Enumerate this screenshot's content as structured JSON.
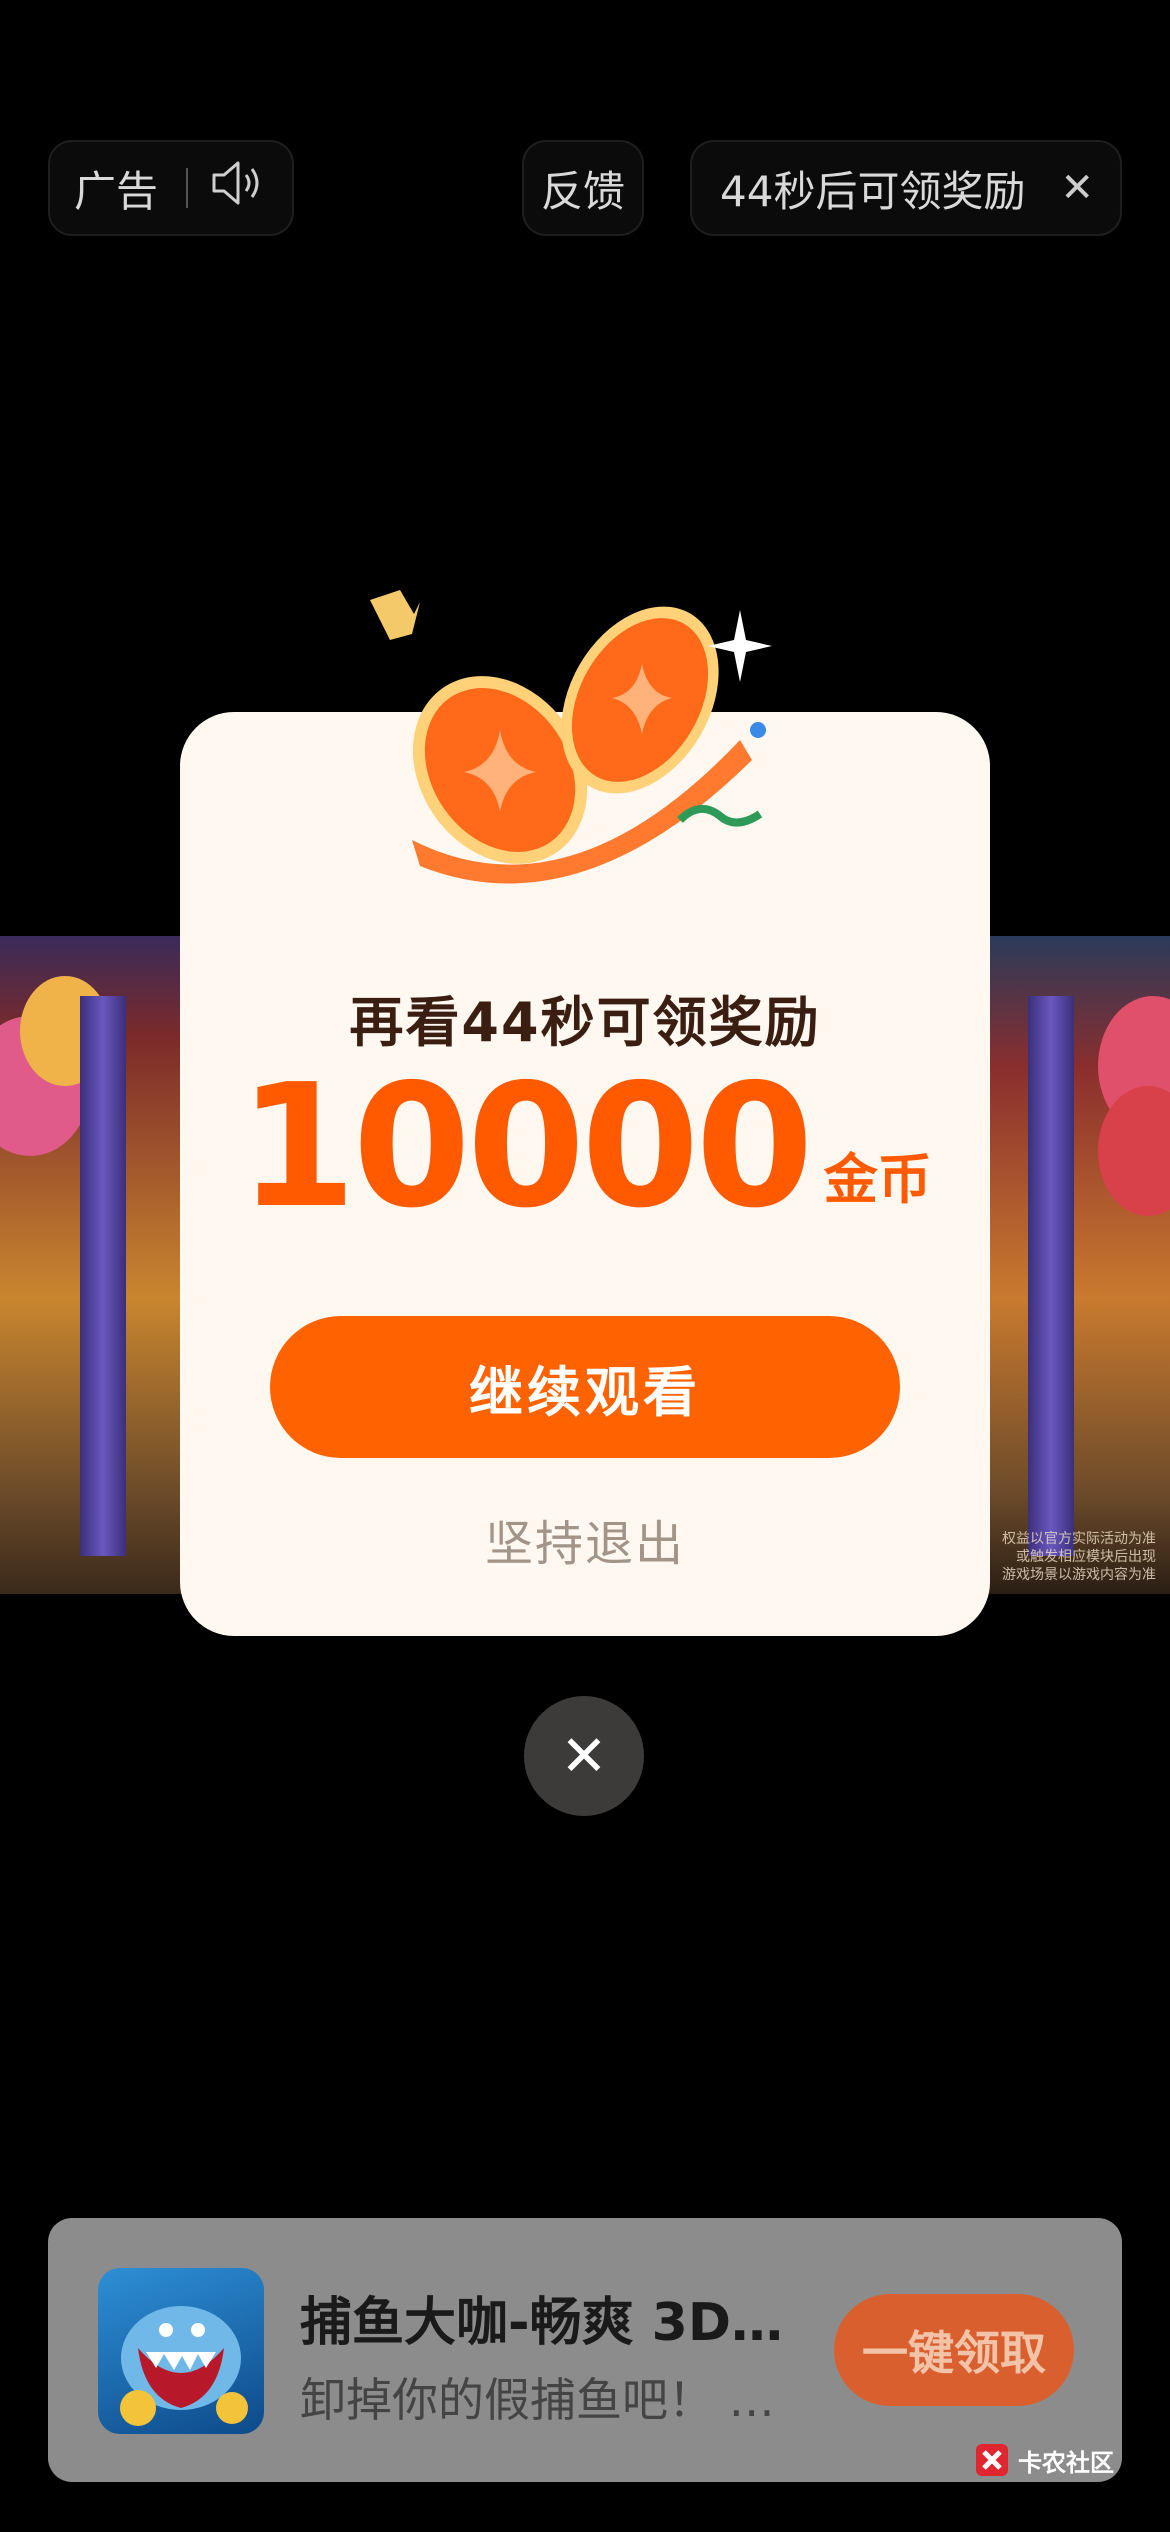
{
  "top_bar": {
    "ad_label": "广告",
    "feedback_label": "反馈",
    "timer_text": "44秒后可领奖励"
  },
  "background": {
    "disclaimer_lines": [
      "权益以官方实际活动为准",
      "或触发相应模块后出现",
      "游戏场景以游戏内容为准"
    ]
  },
  "modal": {
    "title": "再看44秒可领奖励",
    "reward_amount": "10000",
    "reward_unit": "金币",
    "continue_label": "继续观看",
    "exit_label": "坚持退出"
  },
  "ad_card": {
    "app_name": "捕鱼大咖-畅爽 3D…",
    "app_desc": "卸掉你的假捕鱼吧！ …",
    "claim_label": "一键领取"
  },
  "watermark": {
    "text": "卡农社区"
  },
  "colors": {
    "accent": "#ff5a00",
    "button": "#ff6200",
    "modal_bg": "#fff8f1"
  }
}
